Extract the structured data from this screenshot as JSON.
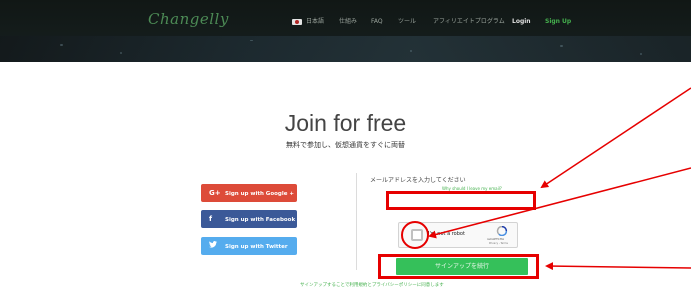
{
  "header": {
    "logo": "Changelly",
    "nav": {
      "language": "日本語",
      "how": "仕組み",
      "faq": "FAQ",
      "tools": "ツール",
      "affiliate": "アフィリエイトプログラム",
      "login": "Login",
      "signup": "Sign Up"
    }
  },
  "main": {
    "title": "Join for free",
    "subtitle": "無料で参加し、仮想通貨をすぐに両替",
    "social": {
      "google": "Sign up with Google +",
      "facebook": "Sign up with Facebook",
      "twitter": "Sign up with Twitter"
    },
    "email": {
      "label": "メールアドレスを入力してください",
      "why_link": "Why should I leave my email?",
      "value": "",
      "placeholder": ""
    },
    "recaptcha": {
      "label": "I'm not a robot",
      "brand": "reCAPTCHA",
      "terms": "Privacy - Terms"
    },
    "submit": "サインアップを続行",
    "terms_text": "サインアップすることで利用規約とプライバシーポリシーに同意します"
  },
  "colors": {
    "annotation": "#e60000",
    "accent": "#45b14e",
    "submit": "#35c05a"
  }
}
